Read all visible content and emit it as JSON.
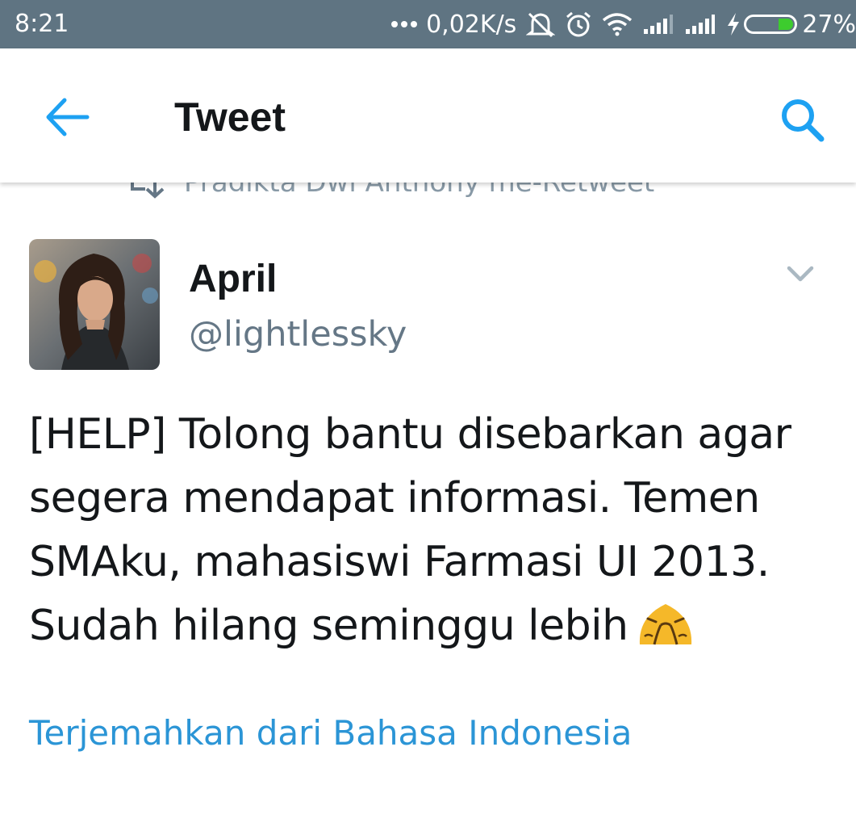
{
  "status_bar": {
    "time": "8:21",
    "net_speed": "0,02K/s",
    "battery_percent": "27%",
    "icons": [
      "more-dots-icon",
      "mute-icon",
      "alarm-icon",
      "wifi-icon",
      "signal-icon",
      "signal-icon",
      "charging-icon",
      "battery-icon"
    ],
    "battery_fill_color": "#3dcc2e"
  },
  "app_bar": {
    "title": "Tweet",
    "back_icon": "arrow-left-icon",
    "search_icon": "search-icon",
    "accent_color": "#1da1f2"
  },
  "tweet": {
    "retweeted_by": "Pradikta Dwi Anthony me-Retweet",
    "author_name": "April",
    "author_handle": "@lightlessky",
    "text_lines": [
      "[HELP] Tolong bantu disebarkan agar",
      "segera mendapat informasi. Temen",
      "SMAku, mahasiswi Farmasi UI 2013.",
      "Sudah hilang seminggu lebih"
    ],
    "emoji": "pleading-hands-emoji",
    "translate_link": "Terjemahkan dari Bahasa Indonesia"
  }
}
